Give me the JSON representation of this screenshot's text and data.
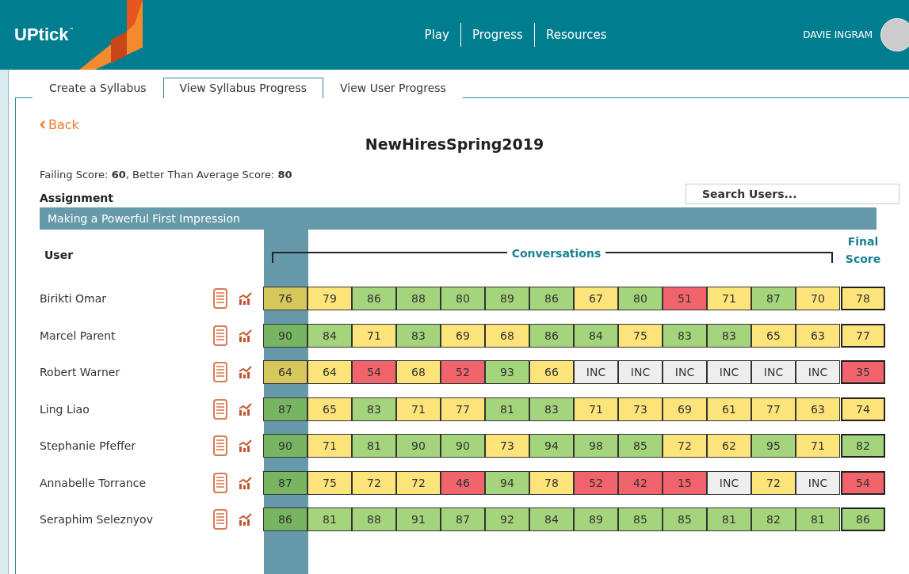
{
  "header": {
    "logo": "UPtick",
    "logo_mark": "™",
    "nav": [
      "Play",
      "Progress",
      "Resources"
    ],
    "user_name": "DAVIE INGRAM"
  },
  "tabs": [
    {
      "label": "Create a Syllabus",
      "selected": false
    },
    {
      "label": "View Syllabus Progress",
      "selected": true
    },
    {
      "label": "View User Progress",
      "selected": false
    }
  ],
  "back_link": "Back",
  "title": "NewHiresSpring2019",
  "score_info": "Failing Score: **60**, Better Than Average Score: **80**",
  "search": {
    "placeholder": "Search Users..."
  },
  "assignment_label": "Assignment",
  "assignment": "Making a Powerful First Impression",
  "table": {
    "user_header": "User",
    "group_header": "Conversations",
    "final_header": "Final Score",
    "columns": [
      {
        "selected": true
      },
      {
        "selected": false
      },
      {
        "selected": false
      },
      {
        "selected": false
      },
      {
        "selected": false
      },
      {
        "selected": false
      },
      {
        "selected": false
      },
      {
        "selected": false
      },
      {
        "selected": false
      },
      {
        "selected": false
      },
      {
        "selected": false
      },
      {
        "selected": false
      },
      {
        "selected": false
      }
    ],
    "rows": [
      {
        "name": "Birikti Omar",
        "cells": [
          {
            "value": "76",
            "color": "#d6c75a"
          },
          {
            "value": "79",
            "color": "#fde47a"
          },
          {
            "value": "86",
            "color": "#a4d47c"
          },
          {
            "value": "88",
            "color": "#a4d47c"
          },
          {
            "value": "80",
            "color": "#a4d47c"
          },
          {
            "value": "89",
            "color": "#a4d47c"
          },
          {
            "value": "86",
            "color": "#a4d47c"
          },
          {
            "value": "67",
            "color": "#fde47a"
          },
          {
            "value": "80",
            "color": "#a4d47c"
          },
          {
            "value": "51",
            "color": "#f2646c"
          },
          {
            "value": "71",
            "color": "#fde47a"
          },
          {
            "value": "87",
            "color": "#a4d47c"
          },
          {
            "value": "70",
            "color": "#fde47a"
          }
        ],
        "final": {
          "value": "78",
          "color": "#fde47a"
        }
      },
      {
        "name": "Marcel Parent",
        "cells": [
          {
            "value": "90",
            "color": "#78b562"
          },
          {
            "value": "84",
            "color": "#a4d47c"
          },
          {
            "value": "71",
            "color": "#fde47a"
          },
          {
            "value": "83",
            "color": "#a4d47c"
          },
          {
            "value": "69",
            "color": "#fde47a"
          },
          {
            "value": "68",
            "color": "#fde47a"
          },
          {
            "value": "86",
            "color": "#a4d47c"
          },
          {
            "value": "84",
            "color": "#a4d47c"
          },
          {
            "value": "75",
            "color": "#fde47a"
          },
          {
            "value": "83",
            "color": "#a4d47c"
          },
          {
            "value": "83",
            "color": "#a4d47c"
          },
          {
            "value": "65",
            "color": "#fde47a"
          },
          {
            "value": "63",
            "color": "#fde47a"
          }
        ],
        "final": {
          "value": "77",
          "color": "#fde47a"
        }
      },
      {
        "name": "Robert Warner",
        "cells": [
          {
            "value": "64",
            "color": "#d6c75a"
          },
          {
            "value": "64",
            "color": "#fde47a"
          },
          {
            "value": "54",
            "color": "#f2646c"
          },
          {
            "value": "68",
            "color": "#fde47a"
          },
          {
            "value": "52",
            "color": "#f2646c"
          },
          {
            "value": "93",
            "color": "#a4d47c"
          },
          {
            "value": "66",
            "color": "#fde47a"
          },
          {
            "value": "INC",
            "color": "#eeeeee"
          },
          {
            "value": "INC",
            "color": "#eeeeee"
          },
          {
            "value": "INC",
            "color": "#eeeeee"
          },
          {
            "value": "INC",
            "color": "#eeeeee"
          },
          {
            "value": "INC",
            "color": "#eeeeee"
          },
          {
            "value": "INC",
            "color": "#eeeeee"
          }
        ],
        "final": {
          "value": "35",
          "color": "#f2646c"
        }
      },
      {
        "name": "Ling Liao",
        "cells": [
          {
            "value": "87",
            "color": "#78b562"
          },
          {
            "value": "65",
            "color": "#fde47a"
          },
          {
            "value": "83",
            "color": "#a4d47c"
          },
          {
            "value": "71",
            "color": "#fde47a"
          },
          {
            "value": "77",
            "color": "#fde47a"
          },
          {
            "value": "81",
            "color": "#a4d47c"
          },
          {
            "value": "83",
            "color": "#a4d47c"
          },
          {
            "value": "71",
            "color": "#fde47a"
          },
          {
            "value": "73",
            "color": "#fde47a"
          },
          {
            "value": "69",
            "color": "#fde47a"
          },
          {
            "value": "61",
            "color": "#fde47a"
          },
          {
            "value": "77",
            "color": "#fde47a"
          },
          {
            "value": "63",
            "color": "#fde47a"
          }
        ],
        "final": {
          "value": "74",
          "color": "#fde47a"
        }
      },
      {
        "name": "Stephanie Pfeffer",
        "cells": [
          {
            "value": "90",
            "color": "#78b562"
          },
          {
            "value": "71",
            "color": "#fde47a"
          },
          {
            "value": "81",
            "color": "#a4d47c"
          },
          {
            "value": "90",
            "color": "#a4d47c"
          },
          {
            "value": "90",
            "color": "#a4d47c"
          },
          {
            "value": "73",
            "color": "#fde47a"
          },
          {
            "value": "94",
            "color": "#a4d47c"
          },
          {
            "value": "98",
            "color": "#a4d47c"
          },
          {
            "value": "85",
            "color": "#a4d47c"
          },
          {
            "value": "72",
            "color": "#fde47a"
          },
          {
            "value": "62",
            "color": "#fde47a"
          },
          {
            "value": "95",
            "color": "#a4d47c"
          },
          {
            "value": "71",
            "color": "#fde47a"
          }
        ],
        "final": {
          "value": "82",
          "color": "#a4d47c"
        }
      },
      {
        "name": "Annabelle Torrance",
        "cells": [
          {
            "value": "87",
            "color": "#78b562"
          },
          {
            "value": "75",
            "color": "#fde47a"
          },
          {
            "value": "72",
            "color": "#fde47a"
          },
          {
            "value": "72",
            "color": "#fde47a"
          },
          {
            "value": "46",
            "color": "#f2646c"
          },
          {
            "value": "94",
            "color": "#a4d47c"
          },
          {
            "value": "78",
            "color": "#fde47a"
          },
          {
            "value": "52",
            "color": "#f2646c"
          },
          {
            "value": "42",
            "color": "#f2646c"
          },
          {
            "value": "15",
            "color": "#f2646c"
          },
          {
            "value": "INC",
            "color": "#eeeeee"
          },
          {
            "value": "72",
            "color": "#fde47a"
          },
          {
            "value": "INC",
            "color": "#eeeeee"
          }
        ],
        "final": {
          "value": "54",
          "color": "#f2646c"
        }
      },
      {
        "name": "Seraphim Seleznyov",
        "cells": [
          {
            "value": "86",
            "color": "#78b562"
          },
          {
            "value": "81",
            "color": "#a4d47c"
          },
          {
            "value": "88",
            "color": "#a4d47c"
          },
          {
            "value": "91",
            "color": "#a4d47c"
          },
          {
            "value": "87",
            "color": "#a4d47c"
          },
          {
            "value": "92",
            "color": "#a4d47c"
          },
          {
            "value": "84",
            "color": "#a4d47c"
          },
          {
            "value": "89",
            "color": "#a4d47c"
          },
          {
            "value": "85",
            "color": "#a4d47c"
          },
          {
            "value": "85",
            "color": "#a4d47c"
          },
          {
            "value": "81",
            "color": "#a4d47c"
          },
          {
            "value": "82",
            "color": "#a4d47c"
          },
          {
            "value": "81",
            "color": "#a4d47c"
          }
        ],
        "final": {
          "value": "86",
          "color": "#a4d47c"
        }
      }
    ]
  }
}
